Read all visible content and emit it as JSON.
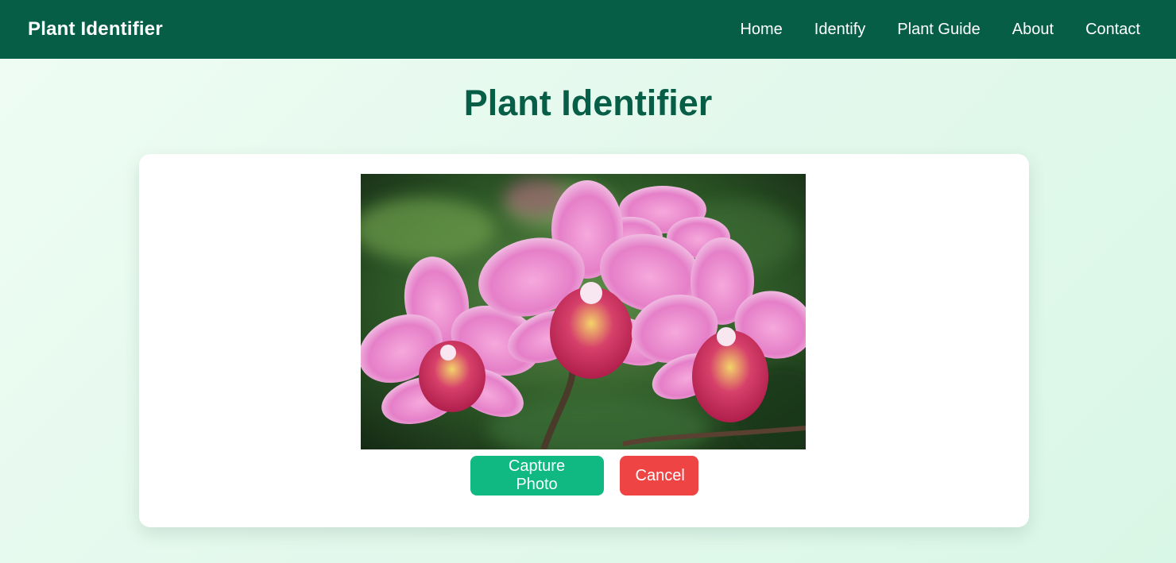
{
  "navbar": {
    "brand": "Plant Identifier",
    "links": [
      "Home",
      "Identify",
      "Plant Guide",
      "About",
      "Contact"
    ]
  },
  "main": {
    "title": "Plant Identifier"
  },
  "camera": {
    "subject": "pink orchid flowers"
  },
  "actions": {
    "capture_label": "Capture Photo",
    "cancel_label": "Cancel"
  },
  "colors": {
    "nav_bg": "#075e47",
    "title": "#075e47",
    "capture": "#10b981",
    "cancel": "#ef4444"
  }
}
